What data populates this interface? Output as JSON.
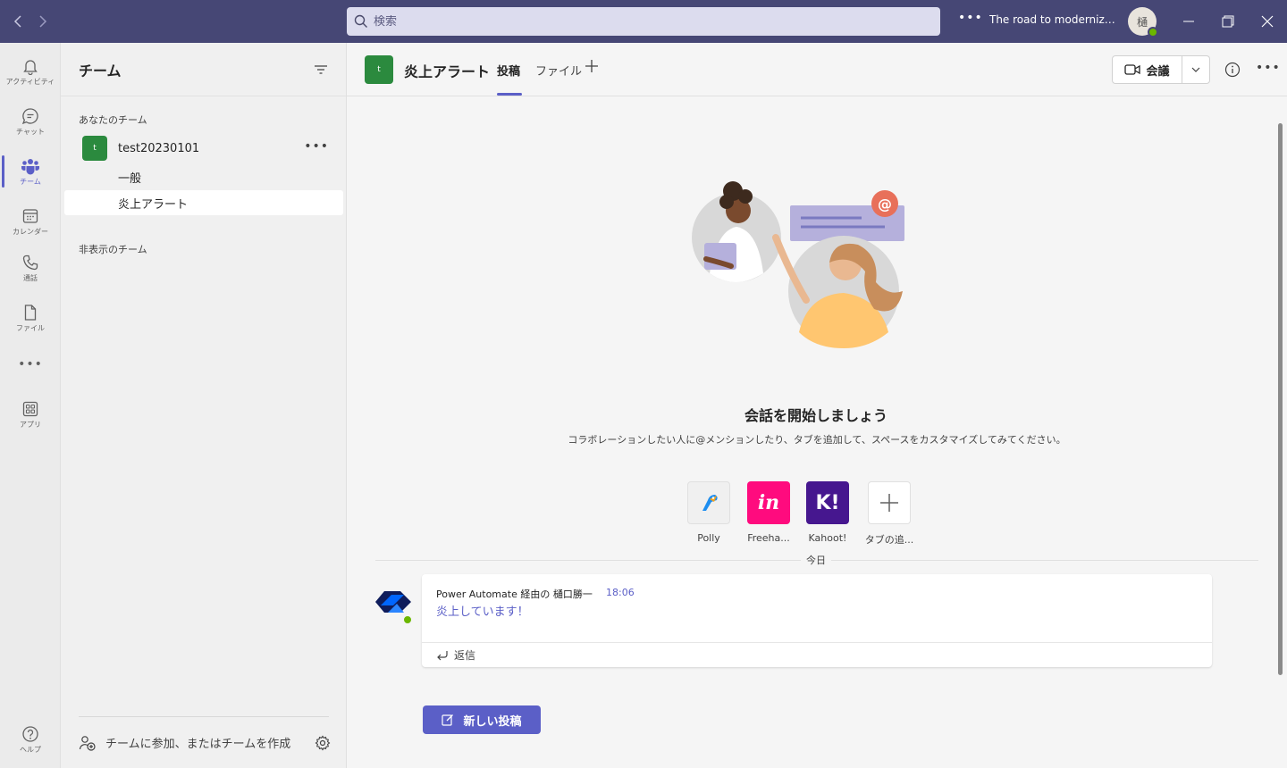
{
  "titlebar": {
    "search_placeholder": "検索",
    "org_name": "The road to modernizati...",
    "avatar_initial": "樋"
  },
  "rail": {
    "items": [
      {
        "label": "アクティビティ",
        "icon": "bell-icon"
      },
      {
        "label": "チャット",
        "icon": "chat-icon"
      },
      {
        "label": "チーム",
        "icon": "teams-icon"
      },
      {
        "label": "カレンダー",
        "icon": "calendar-icon"
      },
      {
        "label": "通話",
        "icon": "phone-icon"
      },
      {
        "label": "ファイル",
        "icon": "file-icon"
      },
      {
        "label": "アプリ",
        "icon": "apps-icon"
      },
      {
        "label": "ヘルプ",
        "icon": "help-icon"
      }
    ],
    "accent_color": "#5b5fc7"
  },
  "teams_panel": {
    "title": "チーム",
    "your_teams_label": "あなたのチーム",
    "team": {
      "avatar": "t",
      "name": "test20230101",
      "avatar_color": "#2b8a3e"
    },
    "channels": [
      "一般",
      "炎上アラート"
    ],
    "hidden_teams_label": "非表示のチーム",
    "footer_text": "チームに参加、またはチームを作成"
  },
  "channel_header": {
    "avatar": "t",
    "title": "炎上アラート",
    "tabs": [
      "投稿",
      "ファイル"
    ],
    "meet_label": "会議"
  },
  "welcome": {
    "title": "会話を開始しましょう",
    "subtitle": "コラボレーションしたい人に@メンションしたり、タブを追加して、スペースをカスタマイズしてみてください。"
  },
  "apps": [
    {
      "label": "Polly"
    },
    {
      "label": "Freeha..."
    },
    {
      "label": "Kahoot!"
    },
    {
      "label": "タブの追..."
    }
  ],
  "feed": {
    "date_label": "今日",
    "message": {
      "author": "Power Automate 経由の 樋口勝一",
      "time": "18:06",
      "body": "炎上しています！",
      "reply_label": "返信"
    },
    "new_post_label": "新しい投稿"
  }
}
